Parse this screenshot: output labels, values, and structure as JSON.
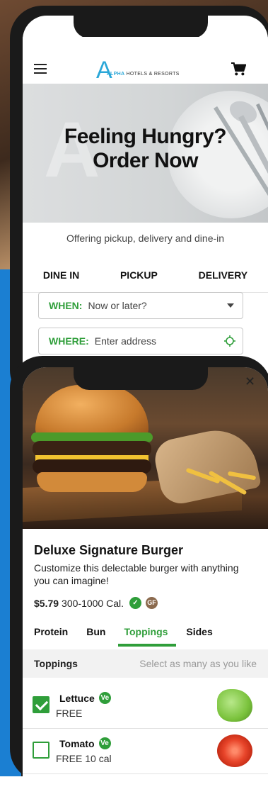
{
  "header": {
    "logo_mark": "A",
    "logo_brand": "ALPHA",
    "logo_tail": "HOTELS & RESORTS"
  },
  "hero": {
    "line1": "Feeling Hungry?",
    "line2": "Order Now"
  },
  "order": {
    "subtitle": "Offering pickup, delivery and dine-in",
    "tabs": [
      "DINE IN",
      "PICKUP",
      "DELIVERY"
    ],
    "when_label": "WHEN:",
    "when_value": "Now or later?",
    "where_label": "WHERE:",
    "where_placeholder": "Enter address"
  },
  "product": {
    "close": "✕",
    "name": "Deluxe Signature Burger",
    "description": "Customize this delectable burger with anything you can imagine!",
    "price": "$5.79",
    "calories": "300-1000 Cal.",
    "badge_gf": "GF",
    "tabs": [
      "Protein",
      "Bun",
      "Toppings",
      "Sides"
    ],
    "active_tab": "Toppings",
    "section_title": "Toppings",
    "section_hint": "Select as many as you like",
    "items": [
      {
        "name": "Lettuce",
        "badge": "Ve",
        "sub": "FREE",
        "checked": true
      },
      {
        "name": "Tomato",
        "badge": "Ve",
        "sub": "FREE 10 cal",
        "checked": false
      }
    ]
  },
  "colors": {
    "accent_green": "#2f9e3a",
    "brand_blue": "#2aa7d8"
  }
}
